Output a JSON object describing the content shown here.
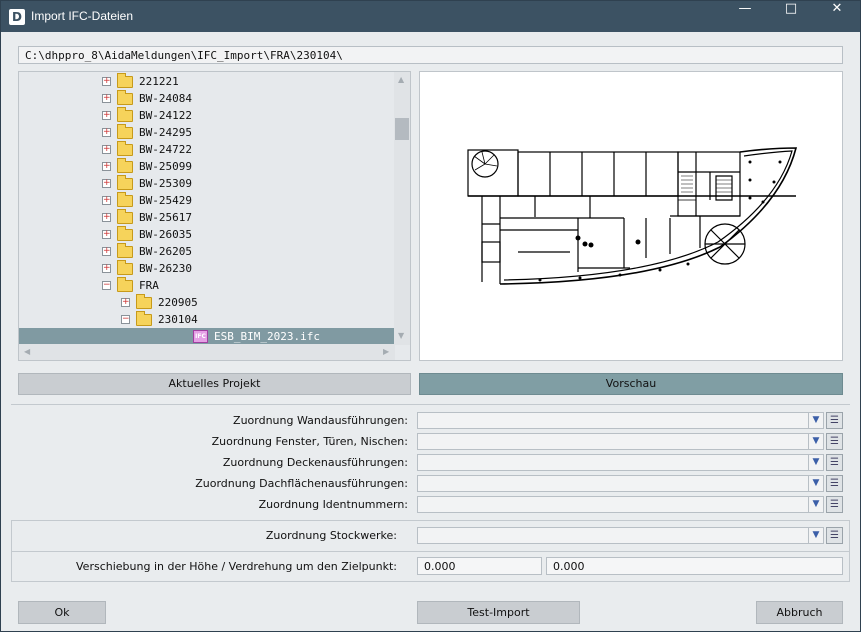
{
  "window": {
    "title": "Import IFC-Dateien",
    "app_icon_letter": "D"
  },
  "path": "C:\\dhppro_8\\AidaMeldungen\\IFC_Import\\FRA\\230104\\",
  "tree": [
    {
      "label": "221221",
      "type": "folder",
      "level": 2,
      "expander": "+"
    },
    {
      "label": "BW-24084",
      "type": "folder",
      "level": 2,
      "expander": "+"
    },
    {
      "label": "BW-24122",
      "type": "folder",
      "level": 2,
      "expander": "+"
    },
    {
      "label": "BW-24295",
      "type": "folder",
      "level": 2,
      "expander": "+"
    },
    {
      "label": "BW-24722",
      "type": "folder",
      "level": 2,
      "expander": "+"
    },
    {
      "label": "BW-25099",
      "type": "folder",
      "level": 2,
      "expander": "+"
    },
    {
      "label": "BW-25309",
      "type": "folder",
      "level": 2,
      "expander": "+"
    },
    {
      "label": "BW-25429",
      "type": "folder",
      "level": 2,
      "expander": "+"
    },
    {
      "label": "BW-25617",
      "type": "folder",
      "level": 2,
      "expander": "+"
    },
    {
      "label": "BW-26035",
      "type": "folder",
      "level": 2,
      "expander": "+"
    },
    {
      "label": "BW-26205",
      "type": "folder",
      "level": 2,
      "expander": "+"
    },
    {
      "label": "BW-26230",
      "type": "folder",
      "level": 2,
      "expander": "+"
    },
    {
      "label": "FRA",
      "type": "folder",
      "level": 2,
      "expander": "−"
    },
    {
      "label": "220905",
      "type": "folder",
      "level": 3,
      "expander": "+"
    },
    {
      "label": "230104",
      "type": "folder",
      "level": 3,
      "expander": "−"
    },
    {
      "label": "ESB_BIM_2023.ifc",
      "type": "file",
      "level": 4,
      "expander": "",
      "selected": true,
      "icon_text": "IFC"
    }
  ],
  "buttons": {
    "current_project": "Aktuelles Projekt",
    "preview": "Vorschau",
    "ok": "Ok",
    "test_import": "Test-Import",
    "cancel": "Abbruch"
  },
  "assignments": [
    {
      "label": "Zuordnung Wandausführungen:",
      "value": ""
    },
    {
      "label": "Zuordnung Fenster, Türen, Nischen:",
      "value": ""
    },
    {
      "label": "Zuordnung Deckenausführungen:",
      "value": ""
    },
    {
      "label": "Zuordnung Dachflächenausführungen:",
      "value": ""
    },
    {
      "label": "Zuordnung Identnummern:",
      "value": ""
    }
  ],
  "storeys": {
    "label": "Zuordnung Stockwerke:",
    "value": ""
  },
  "offset": {
    "label": "Verschiebung in der Höhe / Verdrehung um den Zielpunkt:",
    "height": "0.000",
    "rotation": "0.000"
  },
  "colors": {
    "titlebar": "#3c5263",
    "selection": "#809aa2",
    "active_button": "#809ea4"
  }
}
